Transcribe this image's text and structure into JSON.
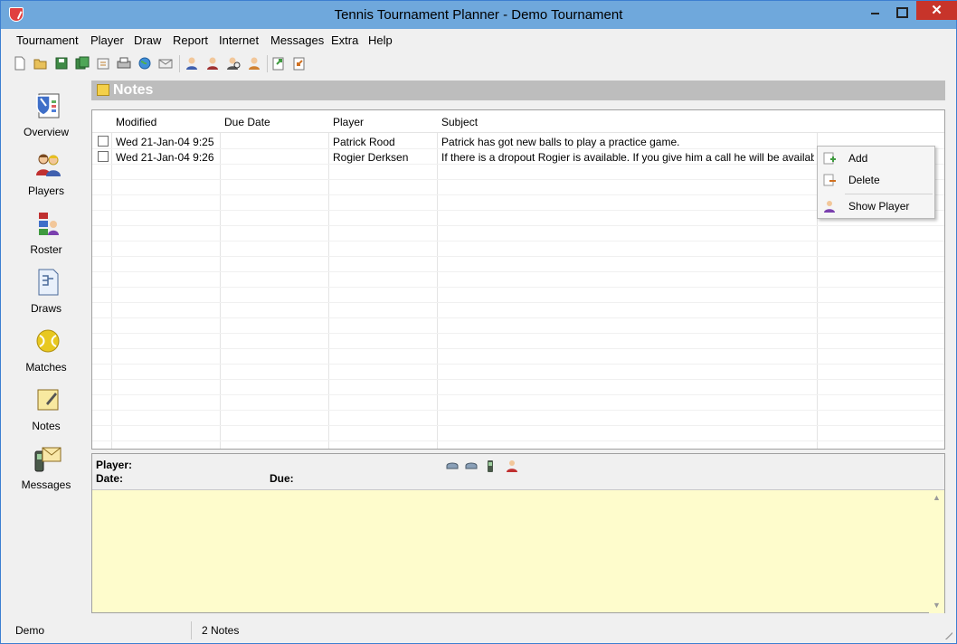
{
  "window": {
    "title": "Tennis Tournament Planner - Demo Tournament",
    "close_glyph": "✕"
  },
  "menu": [
    {
      "label": "Tournament"
    },
    {
      "label": "Player"
    },
    {
      "label": "Draw"
    },
    {
      "label": "Report"
    },
    {
      "label": "Internet"
    },
    {
      "label": "Messages"
    },
    {
      "label": "Extra"
    },
    {
      "label": "Help"
    }
  ],
  "toolbar": {
    "icons": [
      "new-icon",
      "open-icon",
      "save-icon",
      "save-all-icon",
      "properties-icon",
      "print-icon",
      "internet-icon",
      "email-icon",
      "player-icon",
      "player-add-icon",
      "player-search-icon",
      "player-edit-icon",
      "export-icon",
      "import-icon"
    ]
  },
  "sidenav": [
    {
      "label": "Overview",
      "icon": "overview-icon"
    },
    {
      "label": "Players",
      "icon": "players-icon"
    },
    {
      "label": "Roster",
      "icon": "roster-icon"
    },
    {
      "label": "Draws",
      "icon": "draws-icon"
    },
    {
      "label": "Matches",
      "icon": "matches-icon"
    },
    {
      "label": "Notes",
      "icon": "notes-icon"
    },
    {
      "label": "Messages",
      "icon": "messages-icon"
    }
  ],
  "section": {
    "title": "Notes"
  },
  "grid": {
    "columns": [
      "Modified",
      "Due Date",
      "Player",
      "Subject"
    ],
    "rows": [
      {
        "modified": "Wed 21-Jan-04 9:25",
        "due": "",
        "player": "Patrick Rood",
        "subject": "Patrick has got new balls to play a practice game."
      },
      {
        "modified": "Wed 21-Jan-04 9:26",
        "due": "",
        "player": "Rogier Derksen",
        "subject": "If there is a dropout Rogier is available. If you give him a call he will be available in..."
      }
    ]
  },
  "context_menu": {
    "add": "Add",
    "delete": "Delete",
    "show_player": "Show Player"
  },
  "details": {
    "player_label": "Player:",
    "date_label": "Date:",
    "due_label": "Due:"
  },
  "status": {
    "left": "Demo",
    "count": "2 Notes"
  },
  "colors": {
    "titlebar": "#6fa8dc",
    "close": "#c7342a",
    "notes_bg": "#fefccc",
    "header": "#bdbdbd"
  }
}
